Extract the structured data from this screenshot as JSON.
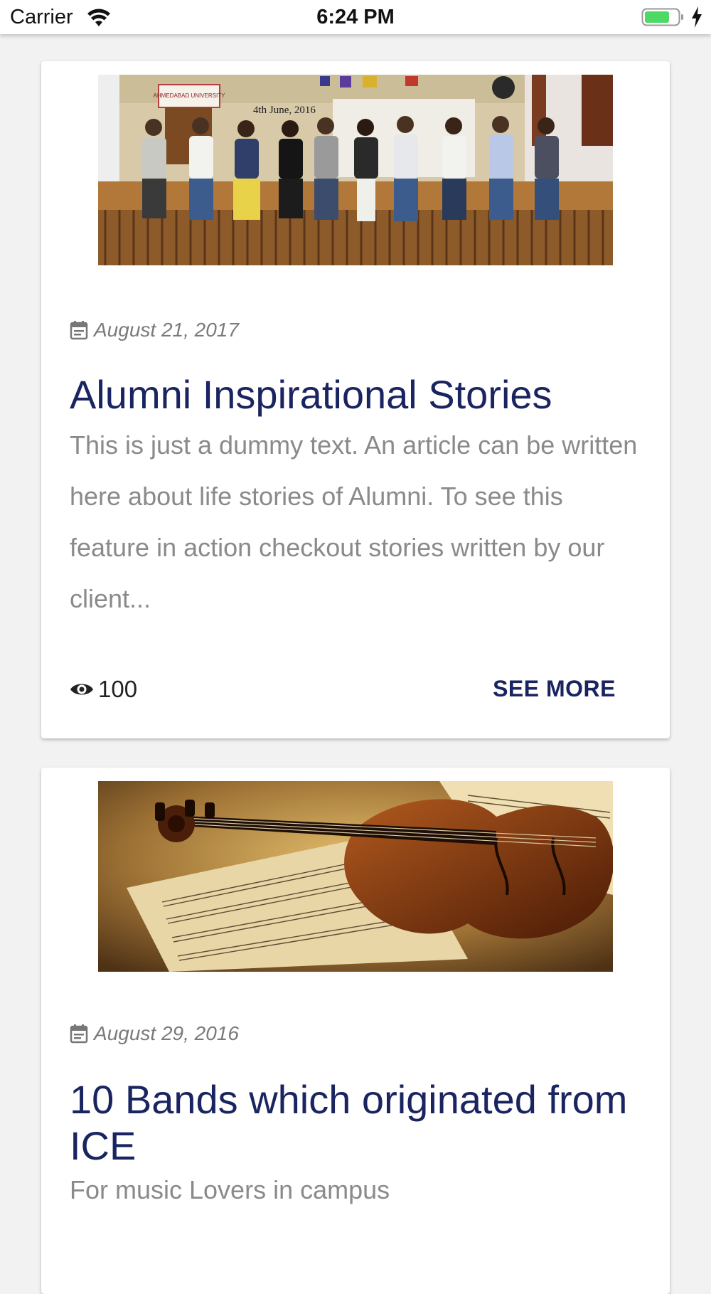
{
  "status_bar": {
    "carrier": "Carrier",
    "time": "6:24 PM"
  },
  "articles": [
    {
      "image": "alumni-group-photo",
      "image_banner_text": "4th June, 2016",
      "image_logo_text": "AHMEDABAD UNIVERSITY",
      "date": "August 21, 2017",
      "title": "Alumni Inspirational Stories",
      "excerpt": "This is just a dummy text. An article can be written here about life stories of Alumni. To see this feature in action checkout stories written by our client...",
      "views": "100",
      "action_label": "SEE MORE"
    },
    {
      "image": "violin-sheet-music-photo",
      "date": "August 29, 2016",
      "title": "10 Bands which originated from ICE",
      "excerpt": "For music Lovers in campus"
    }
  ],
  "colors": {
    "title": "#1a2460",
    "excerpt": "#8a8a8a",
    "date": "#7a7a7a",
    "background": "#f2f2f2"
  },
  "icons": [
    "wifi-icon",
    "battery-icon",
    "charging-bolt-icon",
    "calendar-icon",
    "eye-icon"
  ]
}
